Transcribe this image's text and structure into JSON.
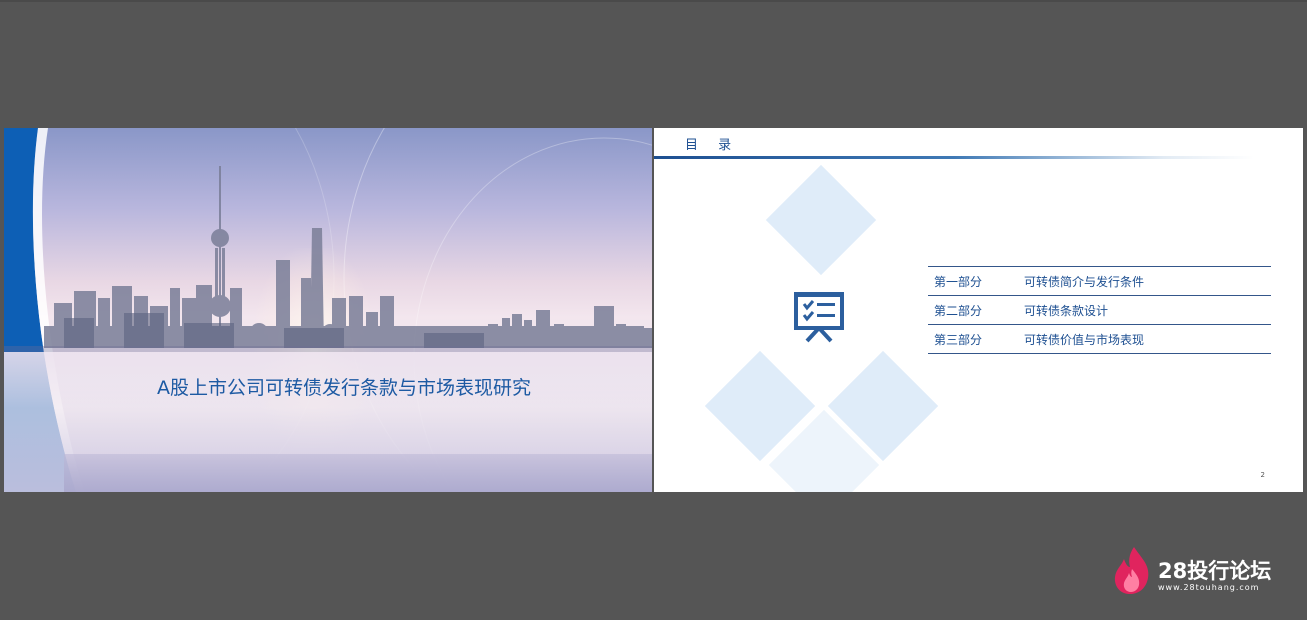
{
  "slide1": {
    "title": "A股上市公司可转债发行条款与市场表现研究"
  },
  "slide2": {
    "heading": "目 录",
    "toc": [
      {
        "part": "第一部分",
        "title": "可转债简介与发行条件"
      },
      {
        "part": "第二部分",
        "title": "可转债条款设计"
      },
      {
        "part": "第三部分",
        "title": "可转债价值与市场表现"
      }
    ],
    "page_number": "2",
    "icon": "presentation-board-icon"
  },
  "watermark": {
    "brand": "28投行论坛",
    "url": "www.28touhang.com",
    "icon": "flame-logo-icon",
    "colors": {
      "accent": "#e0245e"
    }
  },
  "colors": {
    "background": "#555555",
    "title_blue": "#1d5aa3",
    "toc_blue": "#1d4f91",
    "diamond": "#dfecf9"
  }
}
